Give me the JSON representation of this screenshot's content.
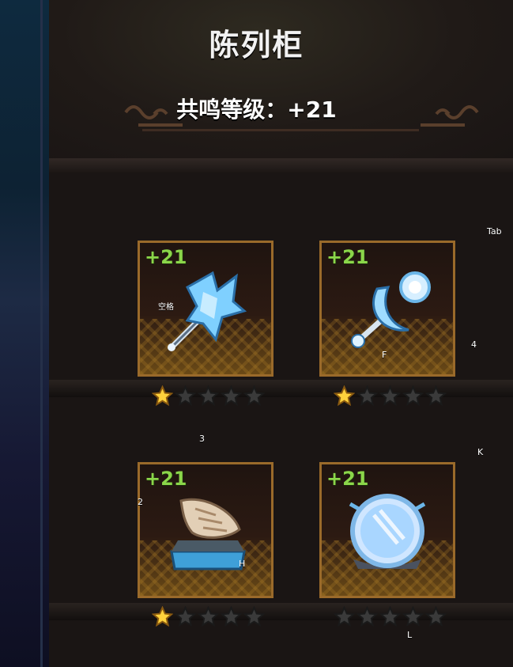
{
  "title": "陈列柜",
  "resonance_label": "共鸣等级：+21",
  "cards": [
    {
      "level": "+21",
      "item": "ice-axe-icon",
      "stars_filled": 1,
      "stars_total": 5
    },
    {
      "level": "+21",
      "item": "crescent-moon-staff-icon",
      "stars_filled": 1,
      "stars_total": 5
    },
    {
      "level": "+21",
      "item": "conch-shell-icon",
      "stars_filled": 1,
      "stars_total": 5
    },
    {
      "level": "+21",
      "item": "frost-mirror-icon",
      "stars_filled": 0,
      "stars_total": 5
    }
  ],
  "hints": {
    "tab": "Tab",
    "space": "空格",
    "f": "F",
    "four": "4",
    "three": "3",
    "k": "K",
    "two": "2",
    "h": "H",
    "l": "L"
  },
  "colors": {
    "level_green": "#8bd64a",
    "card_border": "#9a6a2a",
    "star_gold": "#ffd23c",
    "star_empty": "#3a3a3a"
  }
}
